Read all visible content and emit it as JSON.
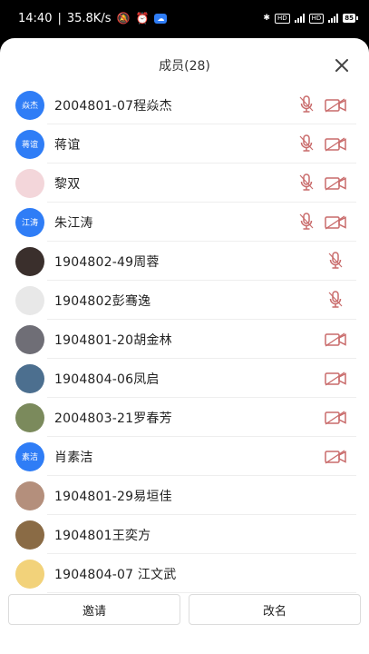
{
  "status_bar": {
    "time": "14:40",
    "net_speed": "35.8K/s",
    "battery": "85"
  },
  "sheet": {
    "title": "成员(28)"
  },
  "members": [
    {
      "name": "2004801-07程焱杰",
      "avatar_type": "text",
      "avatar_text": "焱杰",
      "mic": "muted",
      "cam": "off"
    },
    {
      "name": "蒋谊",
      "avatar_type": "text",
      "avatar_text": "蒋谊",
      "mic": "muted",
      "cam": "off"
    },
    {
      "name": "黎双",
      "avatar_type": "photo",
      "avatar_color": "#f3d6da",
      "mic": "muted",
      "cam": "off"
    },
    {
      "name": "朱江涛",
      "avatar_type": "text",
      "avatar_text": "江涛",
      "mic": "muted",
      "cam": "off"
    },
    {
      "name": "1904802-49周蓉",
      "avatar_type": "photo",
      "avatar_color": "#3a2f2c",
      "mic": "muted-right",
      "cam": "none"
    },
    {
      "name": "1904802彭骞逸",
      "avatar_type": "photo",
      "avatar_color": "#e8e8e8",
      "mic": "muted-right",
      "cam": "none"
    },
    {
      "name": "1904801-20胡金林",
      "avatar_type": "photo",
      "avatar_color": "#6f6e76",
      "mic": "none",
      "cam": "off"
    },
    {
      "name": "1904804-06凤启",
      "avatar_type": "photo",
      "avatar_color": "#4c6f8f",
      "mic": "none",
      "cam": "off"
    },
    {
      "name": "2004803-21罗春芳",
      "avatar_type": "photo",
      "avatar_color": "#7b8a5c",
      "mic": "none",
      "cam": "off"
    },
    {
      "name": "肖素洁",
      "avatar_type": "text",
      "avatar_text": "素洁",
      "mic": "none",
      "cam": "off"
    },
    {
      "name": "1904801-29易垣佳",
      "avatar_type": "photo",
      "avatar_color": "#b48f7c",
      "mic": "none",
      "cam": "none"
    },
    {
      "name": "1904801王奕方",
      "avatar_type": "photo",
      "avatar_color": "#8a6b45",
      "mic": "none",
      "cam": "none"
    },
    {
      "name": "1904804-07 江文武",
      "avatar_type": "photo",
      "avatar_color": "#f2d27a",
      "mic": "none",
      "cam": "none"
    }
  ],
  "footer": {
    "invite_label": "邀请",
    "rename_label": "改名"
  },
  "colors": {
    "accent": "#2f7df6",
    "muted_icon": "#c96b6b",
    "camera_off": "#c96b6b"
  }
}
